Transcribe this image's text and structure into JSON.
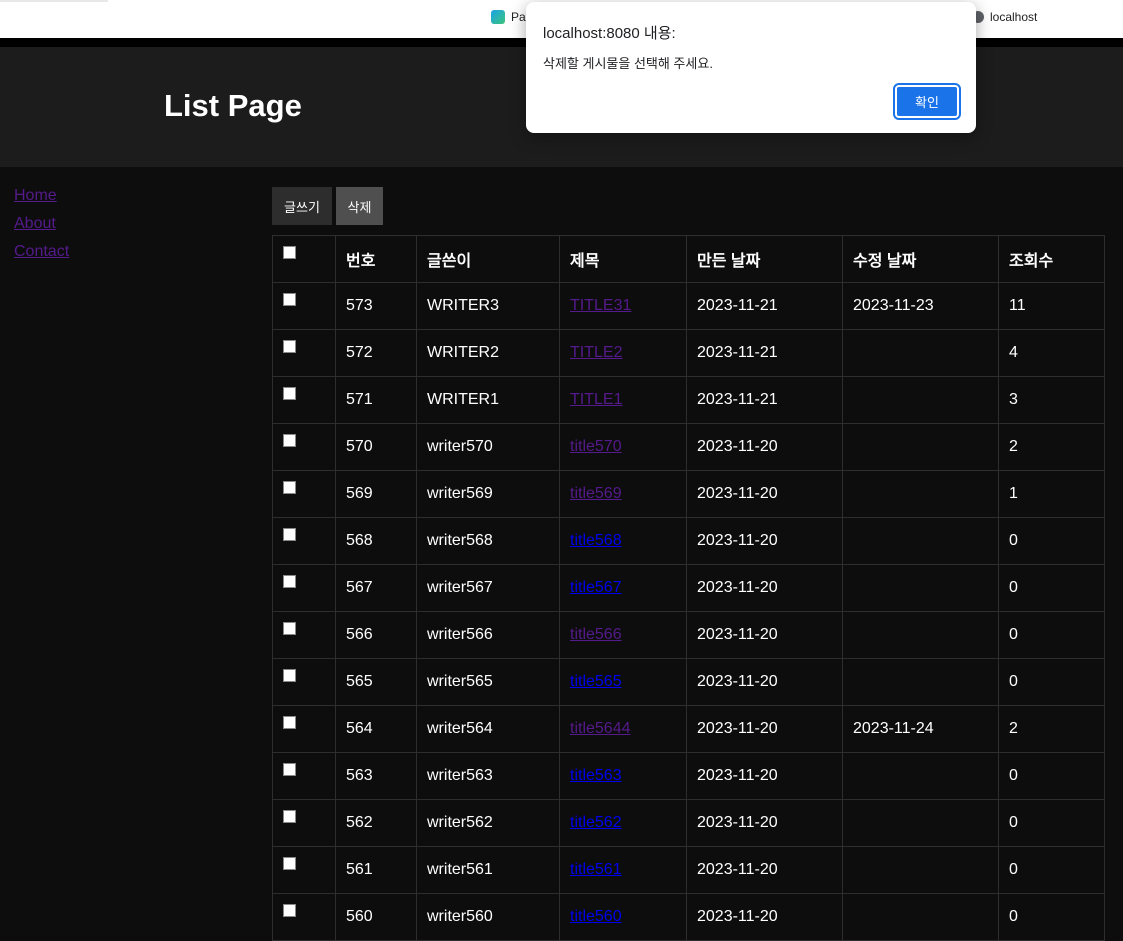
{
  "bookmarks": [
    {
      "label": "Pa",
      "icon": "app-icon"
    },
    {
      "label": "localhost",
      "icon": "globe-icon"
    }
  ],
  "header": {
    "title": "List Page"
  },
  "sidebar": {
    "links": [
      "Home",
      "About",
      "Contact"
    ]
  },
  "actions": {
    "write_label": "글쓰기",
    "delete_label": "삭제"
  },
  "table": {
    "columns": [
      "번호",
      "글쓴이",
      "제목",
      "만든 날짜",
      "수정 날짜",
      "조회수"
    ],
    "rows": [
      {
        "no": "573",
        "writer": "WRITER3",
        "title": "TITLE31",
        "created": "2023-11-21",
        "updated": "2023-11-23",
        "views": "11",
        "visited": true
      },
      {
        "no": "572",
        "writer": "WRITER2",
        "title": "TITLE2",
        "created": "2023-11-21",
        "updated": "",
        "views": "4",
        "visited": true
      },
      {
        "no": "571",
        "writer": "WRITER1",
        "title": "TITLE1",
        "created": "2023-11-21",
        "updated": "",
        "views": "3",
        "visited": true
      },
      {
        "no": "570",
        "writer": "writer570",
        "title": "title570",
        "created": "2023-11-20",
        "updated": "",
        "views": "2",
        "visited": true
      },
      {
        "no": "569",
        "writer": "writer569",
        "title": "title569",
        "created": "2023-11-20",
        "updated": "",
        "views": "1",
        "visited": true
      },
      {
        "no": "568",
        "writer": "writer568",
        "title": "title568",
        "created": "2023-11-20",
        "updated": "",
        "views": "0",
        "visited": false
      },
      {
        "no": "567",
        "writer": "writer567",
        "title": "title567",
        "created": "2023-11-20",
        "updated": "",
        "views": "0",
        "visited": false
      },
      {
        "no": "566",
        "writer": "writer566",
        "title": "title566",
        "created": "2023-11-20",
        "updated": "",
        "views": "0",
        "visited": true
      },
      {
        "no": "565",
        "writer": "writer565",
        "title": "title565",
        "created": "2023-11-20",
        "updated": "",
        "views": "0",
        "visited": false
      },
      {
        "no": "564",
        "writer": "writer564",
        "title": "title5644",
        "created": "2023-11-20",
        "updated": "2023-11-24",
        "views": "2",
        "visited": true
      },
      {
        "no": "563",
        "writer": "writer563",
        "title": "title563",
        "created": "2023-11-20",
        "updated": "",
        "views": "0",
        "visited": false
      },
      {
        "no": "562",
        "writer": "writer562",
        "title": "title562",
        "created": "2023-11-20",
        "updated": "",
        "views": "0",
        "visited": false
      },
      {
        "no": "561",
        "writer": "writer561",
        "title": "title561",
        "created": "2023-11-20",
        "updated": "",
        "views": "0",
        "visited": false
      },
      {
        "no": "560",
        "writer": "writer560",
        "title": "title560",
        "created": "2023-11-20",
        "updated": "",
        "views": "0",
        "visited": false
      }
    ]
  },
  "dialog": {
    "title": "localhost:8080 내용:",
    "message": "삭제할 게시물을 선택해 주세요.",
    "ok_label": "확인"
  },
  "colors": {
    "visited_link": "#551a8b",
    "unvisited_link": "#0000ee",
    "header_bg": "#1c1c1c",
    "page_bg": "#0d0d0d",
    "dialog_button": "#1a73e8"
  }
}
